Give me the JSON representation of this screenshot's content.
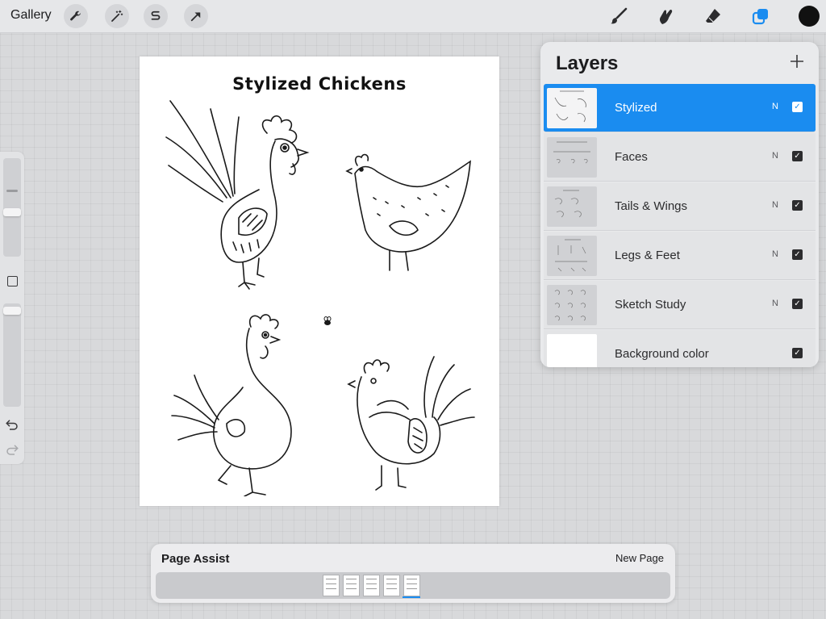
{
  "topbar": {
    "gallery_label": "Gallery",
    "left_tools": [
      "wrench-icon",
      "magic-wand-icon",
      "selection-s-icon",
      "transform-arrow-icon"
    ],
    "right_tools": [
      "brush-icon",
      "smudge-icon",
      "eraser-icon",
      "layers-icon"
    ],
    "current_color": "#111111"
  },
  "sidebar": {
    "brush_size_level": 0.55,
    "opacity_level": 0.97,
    "tools": [
      "modify-square-icon",
      "undo-icon",
      "redo-icon"
    ]
  },
  "canvas": {
    "title": "Stylized Chickens"
  },
  "layers": {
    "title": "Layers",
    "add_icon": "plus-icon",
    "items": [
      {
        "name": "Stylized",
        "mode": "N",
        "visible": true,
        "selected": true
      },
      {
        "name": "Faces",
        "mode": "N",
        "visible": true,
        "selected": false
      },
      {
        "name": "Tails & Wings",
        "mode": "N",
        "visible": true,
        "selected": false
      },
      {
        "name": "Legs & Feet",
        "mode": "N",
        "visible": true,
        "selected": false
      },
      {
        "name": "Sketch Study",
        "mode": "N",
        "visible": true,
        "selected": false
      },
      {
        "name": "Background color",
        "mode": "",
        "visible": true,
        "selected": false
      }
    ],
    "check_glyph": "✓"
  },
  "page_assist": {
    "title": "Page Assist",
    "new_page_label": "New Page",
    "page_count": 5,
    "current_page": 5
  },
  "colors": {
    "accent": "#1a8cf0",
    "panel": "#e9eaec"
  }
}
